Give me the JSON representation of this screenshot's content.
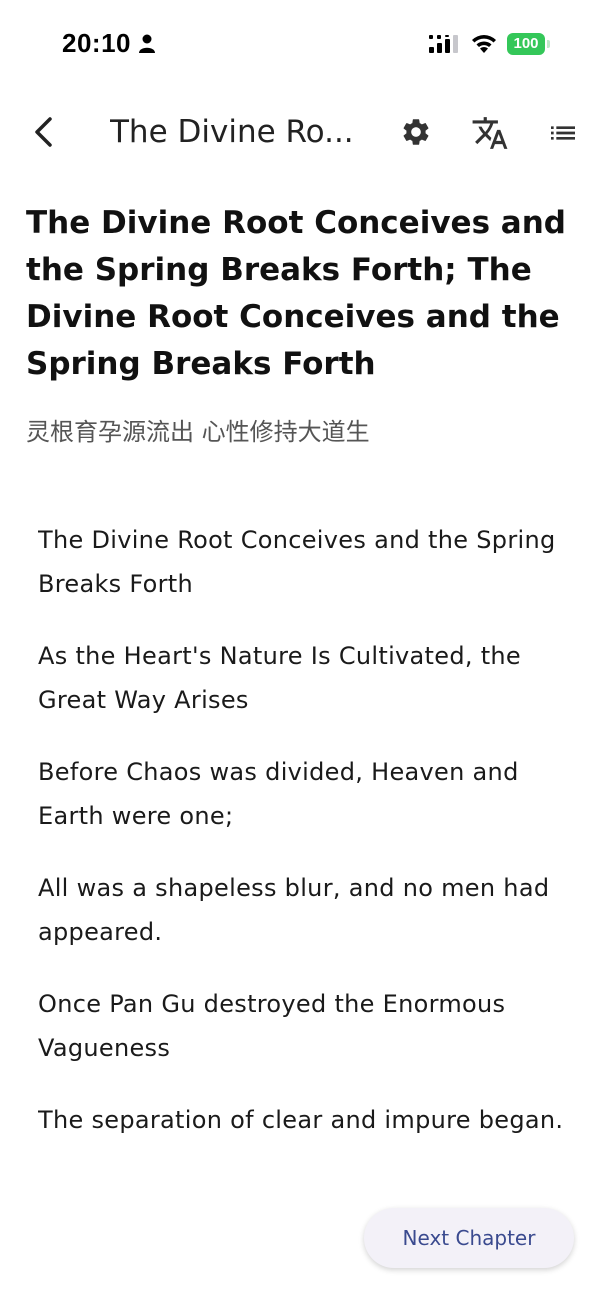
{
  "status_bar": {
    "time": "20:10",
    "battery": "100",
    "icons": [
      "person-icon",
      "signal-icon",
      "wifi-icon",
      "battery-icon"
    ],
    "battery_color": "#34c759"
  },
  "app_bar": {
    "title": "The Divine Ro...",
    "icons": [
      "back-arrow-icon",
      "gear-icon",
      "translate-icon",
      "list-icon"
    ]
  },
  "chapter": {
    "title": "The Divine Root Conceives and the Spring Breaks Forth; The Divine Root Conceives and the Spring Breaks Forth",
    "subtitle": "灵根育孕源流出 心性修持大道生",
    "paragraphs": [
      "The Divine Root Conceives and the Spring Breaks Forth",
      "As the Heart's Nature Is Cultivated, the Great Way Arises",
      "Before Chaos was divided, Heaven and Earth were one;",
      "All was a shapeless blur, and no men had appeared.",
      "Once Pan Gu destroyed the Enormous Vagueness",
      "The separation of clear and impure began."
    ]
  },
  "footer": {
    "next_label": "Next Chapter",
    "accent_color": "#3a4a8f"
  }
}
